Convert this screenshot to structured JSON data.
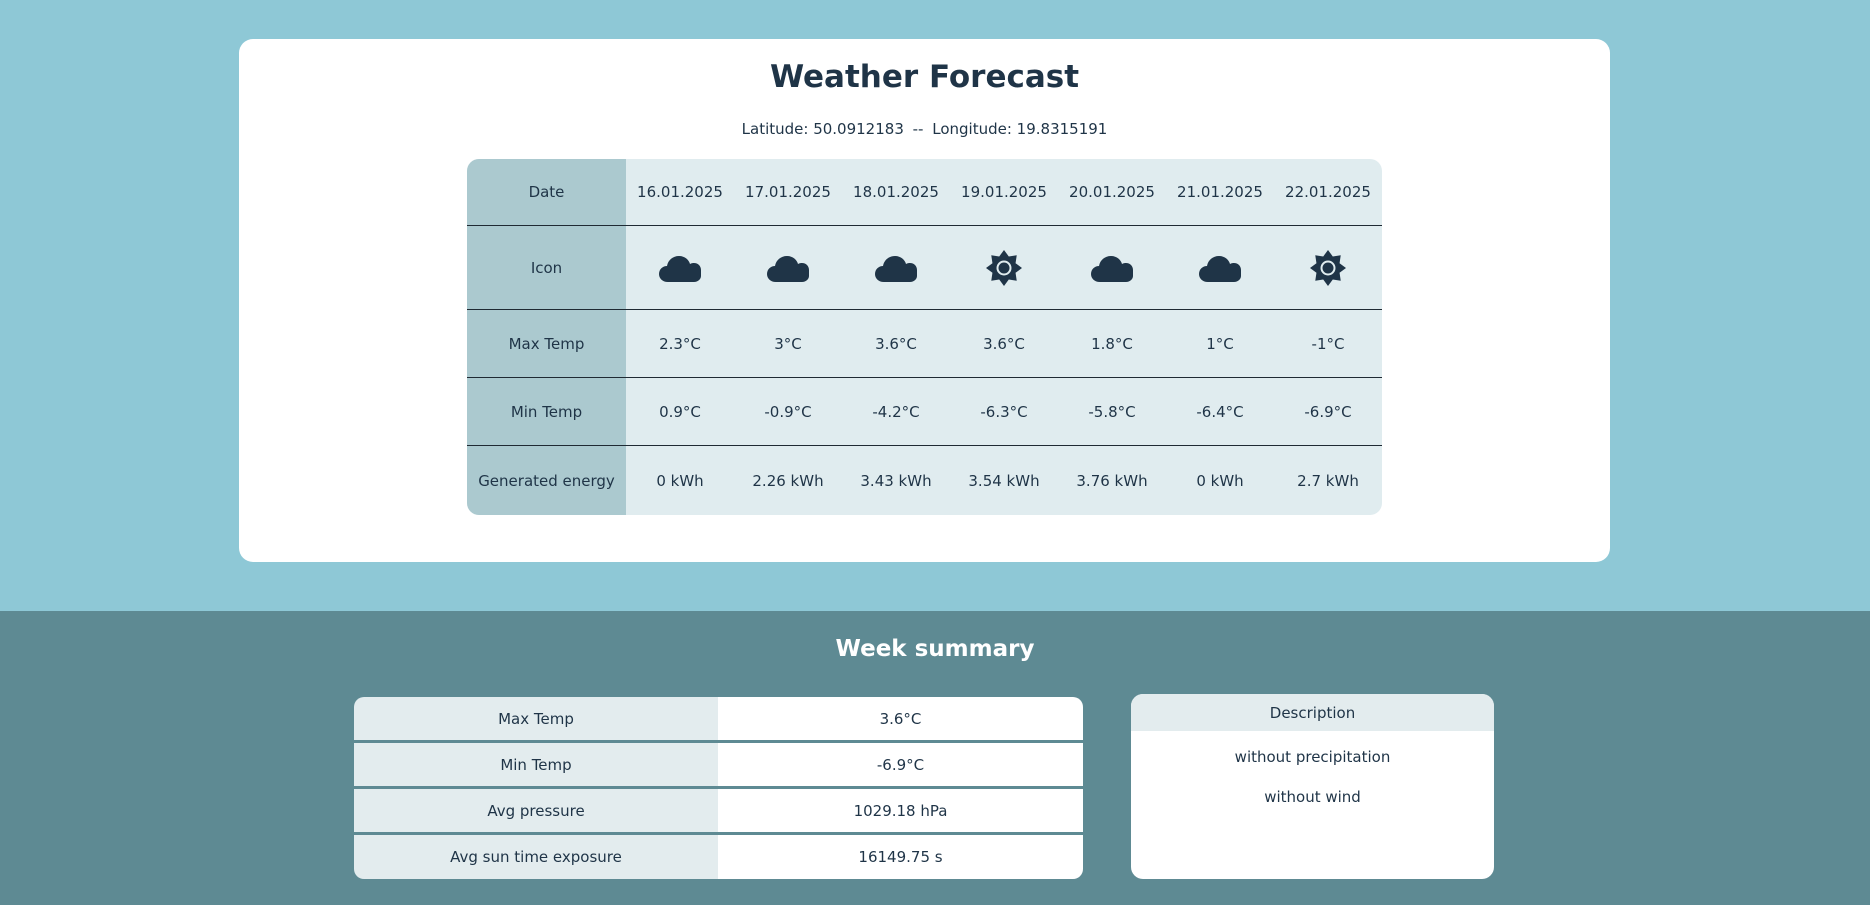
{
  "forecast": {
    "title": "Weather Forecast",
    "latitude_label": "Latitude: 50.0912183",
    "separator": "--",
    "longitude_label": "Longitude: 19.8315191",
    "row_labels": {
      "date": "Date",
      "icon": "Icon",
      "max_temp": "Max Temp",
      "min_temp": "Min Temp",
      "energy": "Generated energy"
    },
    "days": [
      {
        "date": "16.01.2025",
        "icon": "cloud-icon",
        "max": "2.3°C",
        "min": "0.9°C",
        "energy": "0 kWh"
      },
      {
        "date": "17.01.2025",
        "icon": "cloud-icon",
        "max": "3°C",
        "min": "-0.9°C",
        "energy": "2.26 kWh"
      },
      {
        "date": "18.01.2025",
        "icon": "cloud-icon",
        "max": "3.6°C",
        "min": "-4.2°C",
        "energy": "3.43 kWh"
      },
      {
        "date": "19.01.2025",
        "icon": "sun-icon",
        "max": "3.6°C",
        "min": "-6.3°C",
        "energy": "3.54 kWh"
      },
      {
        "date": "20.01.2025",
        "icon": "cloud-icon",
        "max": "1.8°C",
        "min": "-5.8°C",
        "energy": "3.76 kWh"
      },
      {
        "date": "21.01.2025",
        "icon": "cloud-icon",
        "max": "1°C",
        "min": "-6.4°C",
        "energy": "0 kWh"
      },
      {
        "date": "22.01.2025",
        "icon": "sun-icon",
        "max": "-1°C",
        "min": "-6.9°C",
        "energy": "2.7 kWh"
      }
    ]
  },
  "summary": {
    "title": "Week summary",
    "rows": [
      {
        "label": "Max Temp",
        "value": "3.6°C"
      },
      {
        "label": "Min Temp",
        "value": "-6.9°C"
      },
      {
        "label": "Avg pressure",
        "value": "1029.18 hPa"
      },
      {
        "label": "Avg sun time exposure",
        "value": "16149.75 s"
      }
    ],
    "description": {
      "header": "Description",
      "items": [
        "without precipitation",
        "without wind"
      ]
    }
  },
  "colors": {
    "page_bg": "#8ec8d6",
    "summary_bg": "#5e8a93",
    "text": "#1f3447",
    "row_header_bg": "#abc9cf",
    "table_bg": "#e0ecef"
  }
}
